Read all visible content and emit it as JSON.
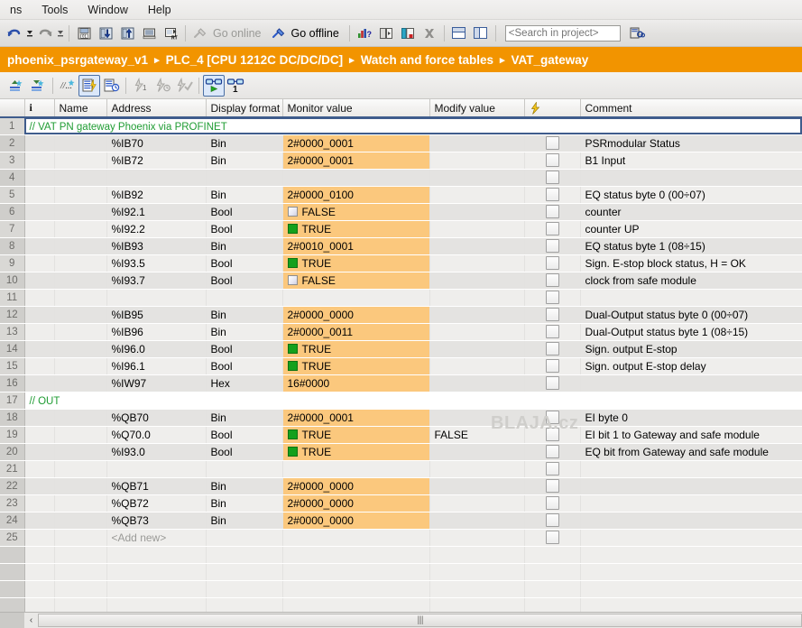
{
  "menu": {
    "items": [
      "ns",
      "Tools",
      "Window",
      "Help"
    ]
  },
  "toolbar": {
    "go_online_label": "Go online",
    "go_offline_label": "Go offline",
    "search_placeholder": "<Search in project>",
    "search_value": ""
  },
  "breadcrumb": {
    "sep": "▸",
    "items": [
      "phoenix_psrgateway_v1",
      "PLC_4 [CPU 1212C DC/DC/DC]",
      "Watch and force tables",
      "VAT_gateway"
    ]
  },
  "watermark": "BLAJA.cz",
  "table": {
    "headers": {
      "rownum": "",
      "info": "i",
      "name": "Name",
      "address": "Address",
      "format": "Display format",
      "monitor": "Monitor value",
      "modify": "Modify value",
      "force": "⚡",
      "comment": "Comment"
    },
    "rows": [
      {
        "n": "1",
        "type": "comment",
        "comment_line": "// VAT PN gateway Phoenix via PROFINET",
        "selected": true
      },
      {
        "n": "2",
        "type": "data",
        "name": "",
        "address": "%IB70",
        "format": "Bin",
        "monitor": "2#0000_0001",
        "monitor_kind": "text",
        "modify": "",
        "force": true,
        "comment": "PSRmodular Status"
      },
      {
        "n": "3",
        "type": "data",
        "name": "",
        "address": "%IB72",
        "format": "Bin",
        "monitor": "2#0000_0001",
        "monitor_kind": "text",
        "modify": "",
        "force": true,
        "comment": "B1 Input"
      },
      {
        "n": "4",
        "type": "empty",
        "name": "",
        "address": "",
        "format": "",
        "monitor": "",
        "monitor_kind": "none",
        "modify": "",
        "force": true,
        "comment": ""
      },
      {
        "n": "5",
        "type": "data",
        "name": "",
        "address": "%IB92",
        "format": "Bin",
        "monitor": "2#0000_0100",
        "monitor_kind": "text",
        "modify": "",
        "force": true,
        "comment": "EQ status byte 0 (00÷07)"
      },
      {
        "n": "6",
        "type": "data",
        "name": "",
        "address": "%I92.1",
        "format": "Bool",
        "monitor": "FALSE",
        "monitor_kind": "bool_false",
        "modify": "",
        "force": true,
        "comment": "counter"
      },
      {
        "n": "7",
        "type": "data",
        "name": "",
        "address": "%I92.2",
        "format": "Bool",
        "monitor": "TRUE",
        "monitor_kind": "bool_true",
        "modify": "",
        "force": true,
        "comment": "counter UP"
      },
      {
        "n": "8",
        "type": "data",
        "name": "",
        "address": "%IB93",
        "format": "Bin",
        "monitor": "2#0010_0001",
        "monitor_kind": "text",
        "modify": "",
        "force": true,
        "comment": "EQ status byte 1 (08÷15)"
      },
      {
        "n": "9",
        "type": "data",
        "name": "",
        "address": "%I93.5",
        "format": "Bool",
        "monitor": "TRUE",
        "monitor_kind": "bool_true",
        "modify": "",
        "force": true,
        "comment": "Sign. E-stop block status, H = OK"
      },
      {
        "n": "10",
        "type": "data",
        "name": "",
        "address": "%I93.7",
        "format": "Bool",
        "monitor": "FALSE",
        "monitor_kind": "bool_false",
        "modify": "",
        "force": true,
        "comment": "clock from safe module"
      },
      {
        "n": "11",
        "type": "empty",
        "name": "",
        "address": "",
        "format": "",
        "monitor": "",
        "monitor_kind": "none",
        "modify": "",
        "force": true,
        "comment": ""
      },
      {
        "n": "12",
        "type": "data",
        "name": "",
        "address": "%IB95",
        "format": "Bin",
        "monitor": "2#0000_0000",
        "monitor_kind": "text",
        "modify": "",
        "force": true,
        "comment": "Dual-Output status byte 0 (00÷07)"
      },
      {
        "n": "13",
        "type": "data",
        "name": "",
        "address": "%IB96",
        "format": "Bin",
        "monitor": "2#0000_0011",
        "monitor_kind": "text",
        "modify": "",
        "force": true,
        "comment": "Dual-Output status byte 1 (08÷15)"
      },
      {
        "n": "14",
        "type": "data",
        "name": "",
        "address": "%I96.0",
        "format": "Bool",
        "monitor": "TRUE",
        "monitor_kind": "bool_true",
        "modify": "",
        "force": true,
        "comment": "Sign. output E-stop"
      },
      {
        "n": "15",
        "type": "data",
        "name": "",
        "address": "%I96.1",
        "format": "Bool",
        "monitor": "TRUE",
        "monitor_kind": "bool_true",
        "modify": "",
        "force": true,
        "comment": "Sign. output E-stop delay"
      },
      {
        "n": "16",
        "type": "data",
        "name": "",
        "address": "%IW97",
        "format": "Hex",
        "monitor": "16#0000",
        "monitor_kind": "text",
        "modify": "",
        "force": true,
        "comment": ""
      },
      {
        "n": "17",
        "type": "comment",
        "comment_line": "// OUT",
        "selected": false
      },
      {
        "n": "18",
        "type": "data",
        "name": "",
        "address": "%QB70",
        "format": "Bin",
        "monitor": "2#0000_0001",
        "monitor_kind": "text",
        "modify": "",
        "force": true,
        "comment": "EI byte 0"
      },
      {
        "n": "19",
        "type": "data",
        "name": "",
        "address": "%Q70.0",
        "format": "Bool",
        "monitor": "TRUE",
        "monitor_kind": "bool_true",
        "modify": "FALSE",
        "force": true,
        "comment": "EI bit 1 to Gateway and safe module"
      },
      {
        "n": "20",
        "type": "data",
        "name": "",
        "address": "%I93.0",
        "format": "Bool",
        "monitor": "TRUE",
        "monitor_kind": "bool_true",
        "modify": "",
        "force": true,
        "comment": "EQ bit from Gateway and safe module"
      },
      {
        "n": "21",
        "type": "empty",
        "name": "",
        "address": "",
        "format": "",
        "monitor": "",
        "monitor_kind": "none",
        "modify": "",
        "force": true,
        "comment": ""
      },
      {
        "n": "22",
        "type": "data",
        "name": "",
        "address": "%QB71",
        "format": "Bin",
        "monitor": "2#0000_0000",
        "monitor_kind": "text",
        "modify": "",
        "force": true,
        "comment": ""
      },
      {
        "n": "23",
        "type": "data",
        "name": "",
        "address": "%QB72",
        "format": "Bin",
        "monitor": "2#0000_0000",
        "monitor_kind": "text",
        "modify": "",
        "force": true,
        "comment": ""
      },
      {
        "n": "24",
        "type": "data",
        "name": "",
        "address": "%QB73",
        "format": "Bin",
        "monitor": "2#0000_0000",
        "monitor_kind": "text",
        "modify": "",
        "force": true,
        "comment": ""
      },
      {
        "n": "25",
        "type": "addnew",
        "name": "",
        "address": "<Add new>",
        "format": "",
        "monitor": "",
        "monitor_kind": "none",
        "modify": "",
        "force": true,
        "comment": ""
      }
    ],
    "blank_row_count": 4
  },
  "colors": {
    "breadcrumb_bg": "#f29400",
    "monitor_bg": "#fbc87d",
    "bool_true": "#14a01c",
    "comment_text": "#1f9c33",
    "header_underline": "#3f5c8c"
  },
  "scrollbar": {
    "left_arrow": "‹",
    "grip": "||||"
  }
}
